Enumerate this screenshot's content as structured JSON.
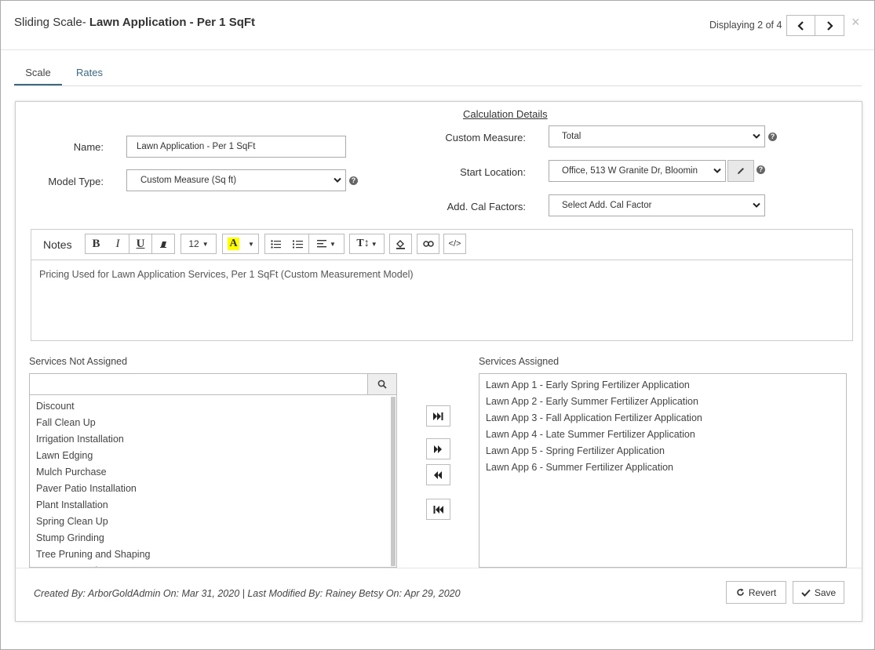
{
  "header": {
    "title_prefix": "Sliding Scale- ",
    "title_name": "Lawn Application - Per 1 SqFt",
    "displaying": "Displaying 2 of 4",
    "close": "×"
  },
  "tabs": [
    {
      "label": "Scale"
    },
    {
      "label": "Rates"
    }
  ],
  "form": {
    "name_label": "Name:",
    "name_value": "Lawn Application - Per 1 SqFt",
    "model_type_label": "Model Type:",
    "model_type_value": "Custom Measure (Sq ft)",
    "calc_details": "Calculation Details",
    "custom_measure_label": "Custom Measure:",
    "custom_measure_value": "Total",
    "start_location_label": "Start Location:",
    "start_location_value": "Office, 513 W Granite Dr, Bloomin",
    "add_cal_label": "Add. Cal Factors:",
    "add_cal_value": "Select Add. Cal Factor"
  },
  "notes": {
    "label": "Notes",
    "font_size": "12",
    "text": "Pricing Used for Lawn Application Services, Per 1 SqFt (Custom Measurement Model)"
  },
  "not_assigned": {
    "title": "Services Not Assigned",
    "items": [
      "Discount",
      "Fall Clean Up",
      "Irrigation Installation",
      "Lawn Edging",
      "Mulch Purchase",
      "Paver Patio Installation",
      "Plant Installation",
      "Spring Clean Up",
      "Stump Grinding",
      "Tree Pruning and Shaping",
      "Tree Removal"
    ]
  },
  "assigned": {
    "title": "Services Assigned",
    "items": [
      "Lawn App 1 - Early Spring Fertilizer Application",
      "Lawn App 2 - Early Summer Fertilizer Application",
      "Lawn App 3 - Fall Application Fertilizer Application",
      "Lawn App 4 - Late Summer Fertilizer Application",
      "Lawn App 5 - Spring Fertilizer Application",
      "Lawn App 6 - Summer Fertilizer Application"
    ]
  },
  "footer": {
    "meta": "Created By:  ArborGoldAdmin  On: Mar 31, 2020  |  Last Modified By:  Rainey Betsy  On: Apr 29, 2020",
    "revert": "Revert",
    "save": "Save"
  }
}
